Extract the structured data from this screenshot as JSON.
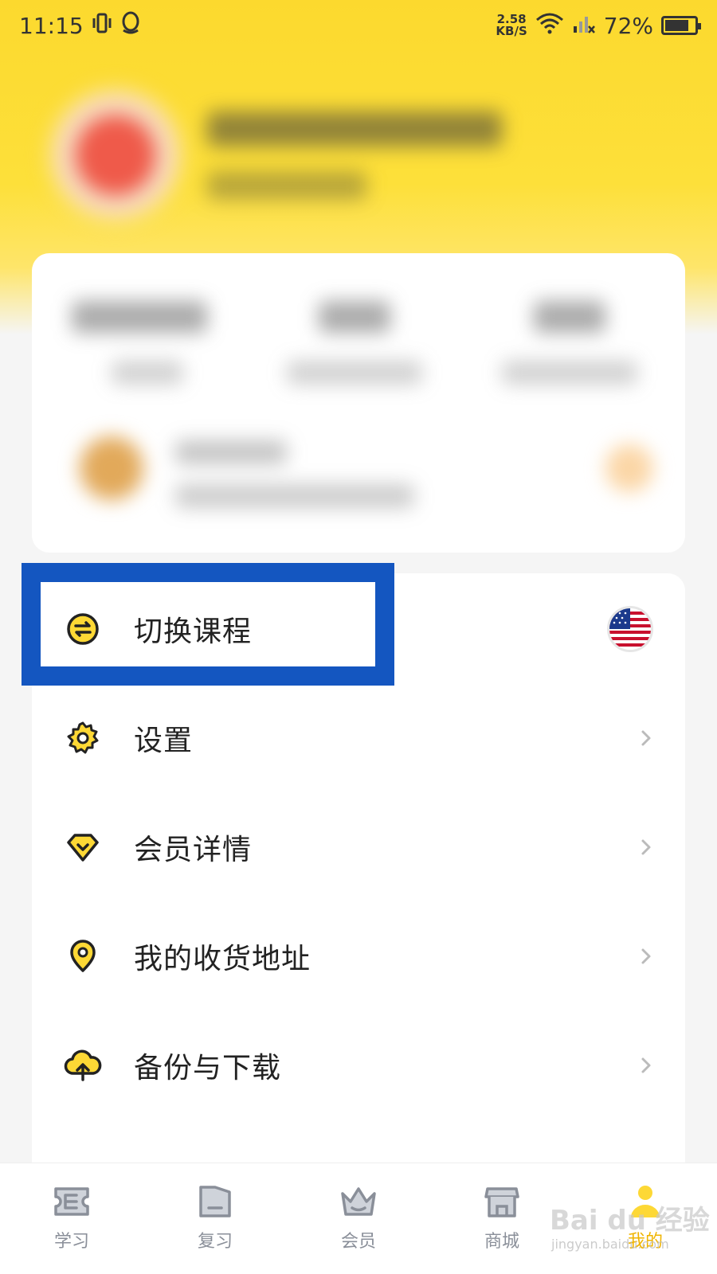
{
  "status_bar": {
    "time": "11:15",
    "net_speed_value": "2.58",
    "net_speed_unit": "KB/S",
    "battery": "72%"
  },
  "menu": {
    "items": [
      {
        "label": "切换课程",
        "icon": "switch-icon",
        "trailing": "us-flag-icon"
      },
      {
        "label": "设置",
        "icon": "gear-icon",
        "trailing": "chevron-right-icon"
      },
      {
        "label": "会员详情",
        "icon": "diamond-icon",
        "trailing": "chevron-right-icon"
      },
      {
        "label": "我的收货地址",
        "icon": "location-pin-icon",
        "trailing": "chevron-right-icon"
      },
      {
        "label": "备份与下载",
        "icon": "cloud-upload-icon",
        "trailing": "chevron-right-icon"
      }
    ]
  },
  "tabbar": {
    "tabs": [
      {
        "label": "学习",
        "icon": "ticket-icon",
        "active": false
      },
      {
        "label": "复习",
        "icon": "folder-icon",
        "active": false
      },
      {
        "label": "会员",
        "icon": "crown-icon",
        "active": false
      },
      {
        "label": "商城",
        "icon": "store-icon",
        "active": false
      },
      {
        "label": "我的",
        "icon": "person-icon",
        "active": true
      }
    ]
  },
  "watermark": {
    "main": "Bai du 经验",
    "sub": "jingyan.baidu.com"
  },
  "colors": {
    "header_yellow": "#fcd92e",
    "accent_yellow": "#fdd835",
    "highlight_blue": "#1456c0",
    "tab_inactive": "#8a8f99",
    "tab_active": "#f0b400"
  }
}
